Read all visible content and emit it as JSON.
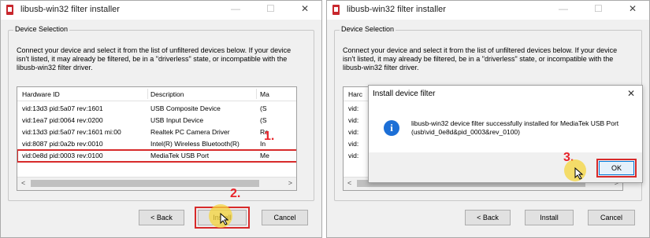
{
  "left_window": {
    "title": "libusb-win32 filter installer",
    "controls": {
      "minimize": "—",
      "maximize": "☐",
      "close": "✕"
    },
    "group_label": "Device Selection",
    "description": "Connect your device and select it from the list of unfiltered devices below. If your device isn't listed, it may already be filtered, be in a \"driverless\" state, or incompatible with the libusb-win32 filter driver.",
    "columns": [
      "Hardware ID",
      "Description",
      "Ma"
    ],
    "rows": [
      {
        "hwid": "vid:13d3 pid:5a07 rev:1601",
        "desc": "USB Composite Device",
        "mfr": "(S"
      },
      {
        "hwid": "vid:1ea7 pid:0064 rev:0200",
        "desc": "USB Input Device",
        "mfr": "(S"
      },
      {
        "hwid": "vid:13d3 pid:5a07 rev:1601 mi:00",
        "desc": "Realtek PC Camera Driver",
        "mfr": "Re"
      },
      {
        "hwid": "vid:8087 pid:0a2b rev:0010",
        "desc": "Intel(R) Wireless Bluetooth(R)",
        "mfr": "In"
      },
      {
        "hwid": "vid:0e8d pid:0003 rev:0100",
        "desc": "MediaTek USB Port",
        "mfr": "Me"
      }
    ],
    "back_label": "< Back",
    "install_label": "Install",
    "cancel_label": "Cancel",
    "step1": "1.",
    "step2": "2."
  },
  "right_window": {
    "title": "libusb-win32 filter installer",
    "controls": {
      "minimize": "—",
      "maximize": "☐",
      "close": "✕"
    },
    "group_label": "Device Selection",
    "description": "Connect your device and select it from the list of unfiltered devices below. If your device isn't listed, it may already be filtered, be in a \"driverless\" state, or incompatible with the libusb-win32 filter driver.",
    "column_partial": "Harc",
    "rows_partial": [
      "vid:",
      "vid:",
      "vid:",
      "vid:",
      "vid:"
    ],
    "back_label": "< Back",
    "install_label": "Install",
    "cancel_label": "Cancel",
    "step3": "3."
  },
  "dialog": {
    "title": "Install device filter",
    "close": "✕",
    "message": "libusb-win32 device filter successfully installed for MediaTek USB Port (usb\\vid_0e8d&pid_0003&rev_0100)",
    "ok_label": "OK",
    "icon": "info-icon"
  },
  "colors": {
    "highlight": "#d72a2a",
    "step_red": "#e8232a",
    "info_blue": "#1c6fd6",
    "cursor_halo": "#f6d63c"
  }
}
